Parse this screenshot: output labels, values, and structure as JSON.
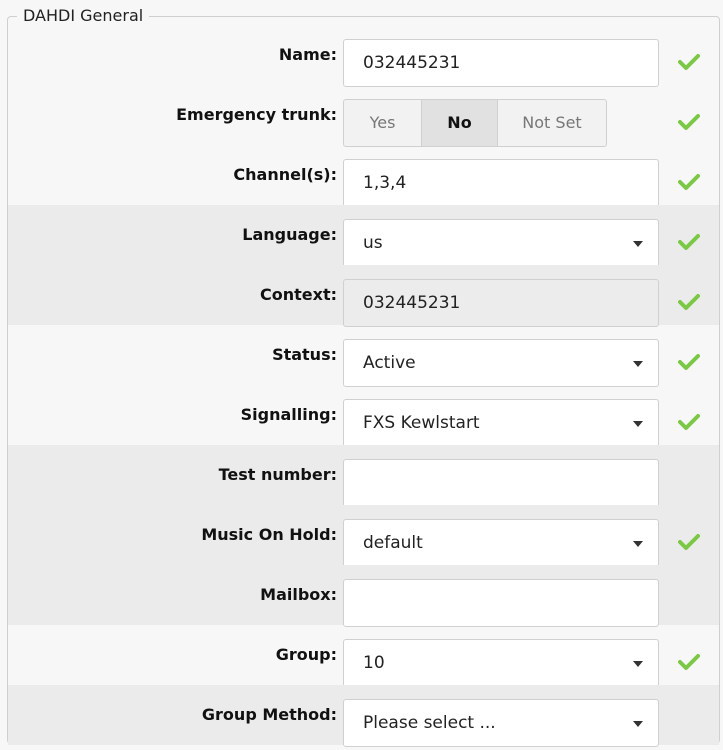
{
  "section": {
    "title": "DAHDI General"
  },
  "fields": {
    "name": {
      "label": "Name:",
      "value": "032445231"
    },
    "emergency": {
      "label": "Emergency trunk:",
      "options": [
        "Yes",
        "No",
        "Not Set"
      ],
      "selected": "No"
    },
    "channels": {
      "label": "Channel(s):",
      "value": "1,3,4"
    },
    "language": {
      "label": "Language:",
      "value": "us"
    },
    "context": {
      "label": "Context:",
      "value": "032445231"
    },
    "status": {
      "label": "Status:",
      "value": "Active"
    },
    "signalling": {
      "label": "Signalling:",
      "value": "FXS Kewlstart"
    },
    "test_number": {
      "label": "Test number:",
      "value": ""
    },
    "moh": {
      "label": "Music On Hold:",
      "value": "default"
    },
    "mailbox": {
      "label": "Mailbox:",
      "value": ""
    },
    "group": {
      "label": "Group:",
      "value": "10"
    },
    "group_method": {
      "label": "Group Method:",
      "value": "Please select ..."
    }
  },
  "icons": {
    "valid": "check-icon"
  },
  "colors": {
    "check": "#7ac943",
    "shade": "#ebebeb"
  }
}
